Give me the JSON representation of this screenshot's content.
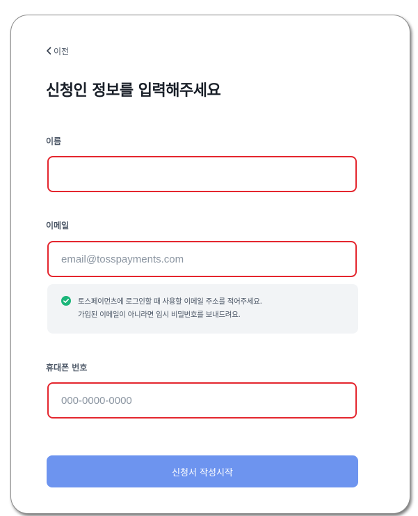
{
  "nav": {
    "back_label": "이전"
  },
  "page": {
    "title": "신청인 정보를 입력해주세요"
  },
  "form": {
    "name": {
      "label": "이름",
      "value": "",
      "placeholder": ""
    },
    "email": {
      "label": "이메일",
      "value": "",
      "placeholder": "email@tosspayments.com"
    },
    "notice": {
      "icon": "check-circle-icon",
      "line1": "토스페이먼츠에 로그인할 때 사용할 이메일 주소를 적어주세요.",
      "line2": "가입된 이메일이 아니라면 임시 비밀번호를 보내드려요."
    },
    "phone": {
      "label": "휴대폰 번호",
      "value": "",
      "placeholder": "000-0000-0000"
    },
    "submit_label": "신청서 작성시작"
  },
  "colors": {
    "accent": "#6d94ef",
    "error_border": "#e4262e",
    "notice_bg": "#f2f4f6",
    "check_green": "#1cb67a",
    "title": "#191f28"
  }
}
